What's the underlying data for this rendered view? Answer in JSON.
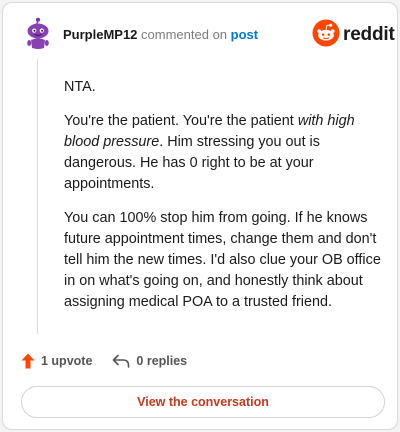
{
  "comment": {
    "username": "PurpleMP12",
    "action_text": "commented on",
    "post_link": "post",
    "body": {
      "p1": "NTA.",
      "p2_prefix": "You're the patient. You're the patient ",
      "p2_emphasis": "with high blood pressure",
      "p2_suffix": ". Him stressing you out is dangerous. He has 0 right to be at your appointments.",
      "p3": "You can 100% stop him from going. If he knows future appointment times, change them and don't tell him the new times. I'd also clue your OB office in on what's going on, and honestly think about assigning medical POA to a trusted friend."
    }
  },
  "brand": {
    "name": "reddit",
    "color": "#ff4500"
  },
  "footer": {
    "upvotes": "1 upvote",
    "replies": "0 replies"
  },
  "cta": {
    "label": "View the conversation"
  },
  "colors": {
    "accent": "#ff4500",
    "link": "#0079d3",
    "cta_text": "#c9381a",
    "avatar": "#8a3fb5"
  },
  "icons": [
    "avatar-snoo-icon",
    "reddit-logo-icon",
    "upvote-arrow-icon",
    "reply-arrow-icon"
  ]
}
